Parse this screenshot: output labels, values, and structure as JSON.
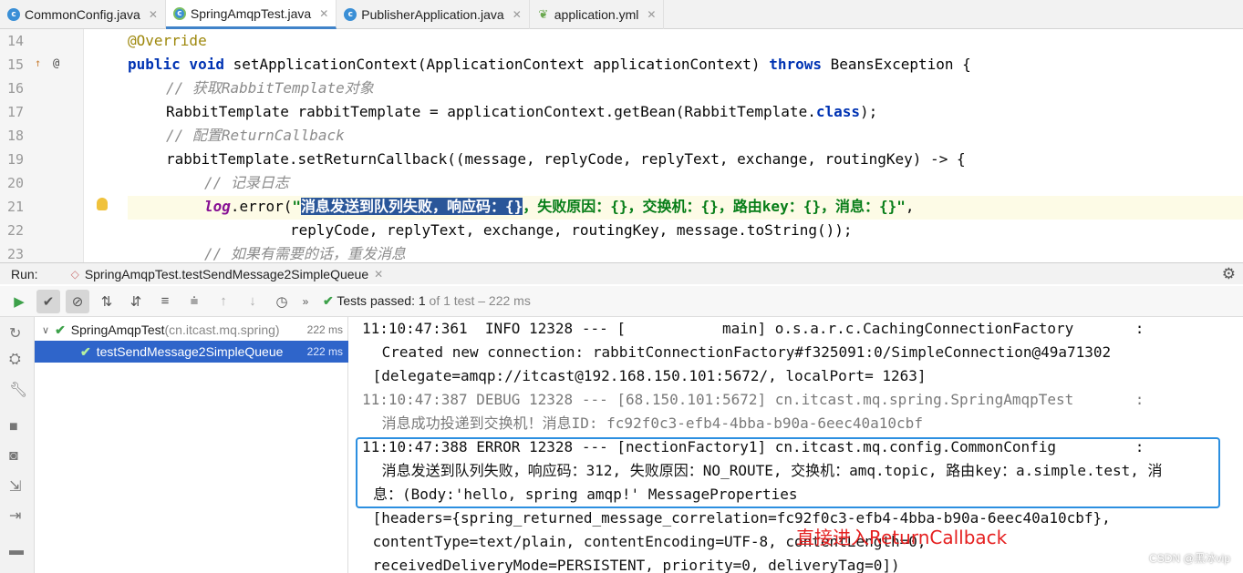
{
  "tabs": [
    {
      "name": "CommonConfig.java",
      "icon": "class-icon"
    },
    {
      "name": "SpringAmqpTest.java",
      "icon": "test-class-icon"
    },
    {
      "name": "PublisherApplication.java",
      "icon": "spring-class-icon"
    },
    {
      "name": "application.yml",
      "icon": "spring-leaf-icon"
    }
  ],
  "editor": {
    "line_numbers": [
      "14",
      "15",
      "16",
      "17",
      "18",
      "19",
      "20",
      "21",
      "22",
      "23"
    ],
    "lines": [
      "@Override",
      "public void setApplicationContext(ApplicationContext applicationContext) throws BeansException {",
      "// 获取RabbitTemplate对象",
      "RabbitTemplate rabbitTemplate = applicationContext.getBean(RabbitTemplate.class);",
      "// 配置ReturnCallback",
      "rabbitTemplate.setReturnCallback((message, replyCode, replyText, exchange, routingKey) -> {",
      "// 记录日志",
      "log.error(\"消息发送到队列失败，响应码：{}，失败原因：{}，交换机：{}，路由key：{}，消息：{}\",",
      "replyCode, replyText, exchange, routingKey, message.toString());",
      "// 如果有需要的话，重发消息"
    ],
    "selected_text": "消息发送到队列失败，响应码：{}"
  },
  "run": {
    "label": "Run:",
    "config_name": "SpringAmqpTest.testSendMessage2SimpleQueue",
    "status_main": "Tests passed: 1",
    "status_detail": " of 1 test – 222 ms"
  },
  "tree": [
    {
      "name": "SpringAmqpTest",
      "pkg": " (cn.itcast.mq.spring)",
      "time": "222 ms"
    },
    {
      "name": "testSendMessage2SimpleQueue",
      "time": "222 ms"
    }
  ],
  "console": [
    "11:10:47:361  INFO 12328 --- [           main] o.s.a.r.c.CachingConnectionFactory       :",
    " Created new connection: rabbitConnectionFactory#f325091:0/SimpleConnection@49a71302",
    " [delegate=amqp://itcast@192.168.150.101:5672/, localPort= 1263]",
    "11:10:47:387 DEBUG 12328 --- [68.150.101:5672] cn.itcast.mq.spring.SpringAmqpTest       :",
    " 消息成功投递到交换机！消息ID: fc92f0c3-efb4-4bba-b90a-6eec40a10cbf",
    "11:10:47:388 ERROR 12328 --- [nectionFactory1] cn.itcast.mq.config.CommonConfig         :",
    " 消息发送到队列失败，响应码：312, 失败原因：NO_ROUTE, 交换机：amq.topic, 路由key：a.simple.test, 消",
    "息：(Body:'hello, spring amqp!' MessageProperties",
    " [headers={spring_returned_message_correlation=fc92f0c3-efb4-4bba-b90a-6eec40a10cbf},",
    " contentType=text/plain, contentEncoding=UTF-8, contentLength=0,",
    " receivedDeliveryMode=PERSISTENT, priority=0, deliveryTag=0])"
  ],
  "annotation": "直接进入ReturnCallback",
  "watermark": "CSDN @黑冰vip",
  "colors": {
    "highlight": "#ffd200",
    "box": "#2c8fe0",
    "note": "#e52020",
    "selection": "#2f65ca"
  }
}
